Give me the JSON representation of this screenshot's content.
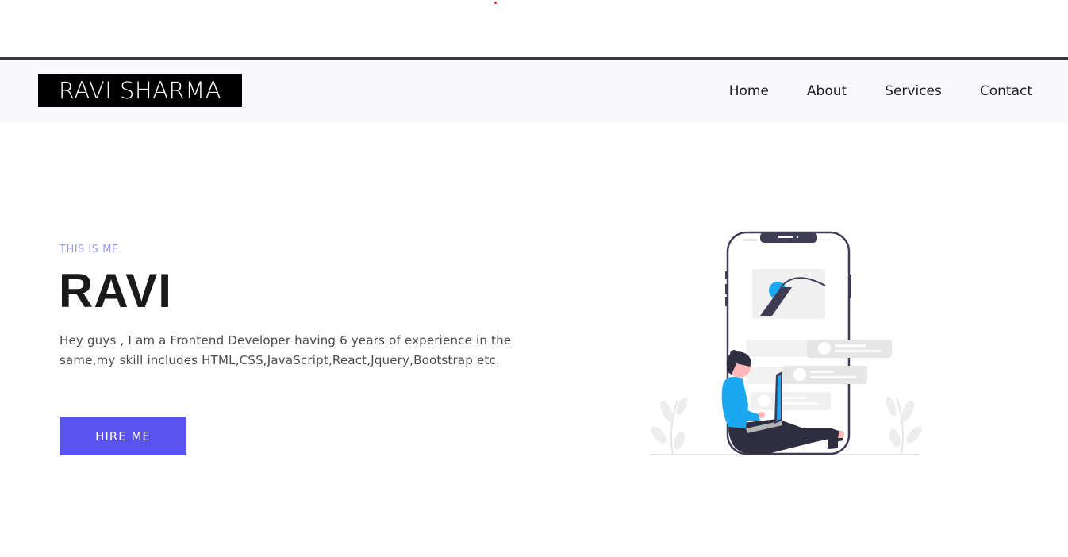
{
  "brand": {
    "logo_text": "RAVI SHARMA"
  },
  "nav": {
    "items": [
      {
        "label": "Home"
      },
      {
        "label": "About"
      },
      {
        "label": "Services"
      },
      {
        "label": "Contact"
      }
    ]
  },
  "hero": {
    "kicker": "THIS IS ME",
    "title": "RAVI",
    "description": "Hey guys , I am a Frontend Developer having 6 years of experience in the same,my skill includes HTML,CSS,JavaScript,React,Jquery,Bootstrap etc.",
    "cta_label": "HIRE ME"
  },
  "colors": {
    "accent": "#5b53ef",
    "kicker": "#9b9af3",
    "illustration_blue": "#1aa8f0"
  },
  "illustration": {
    "icon": "person-with-laptop-phone-illustration"
  }
}
